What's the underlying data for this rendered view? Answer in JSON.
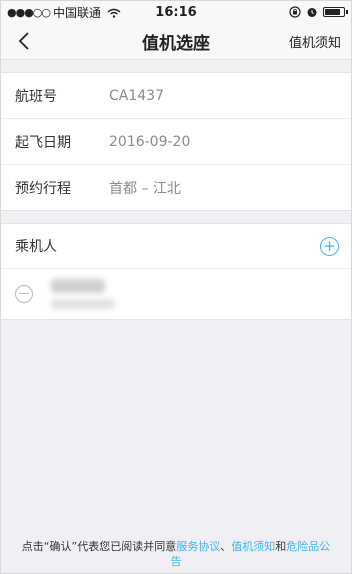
{
  "status_bar": {
    "signal": "●●●○○",
    "carrier": "中国联通",
    "time": "16:16",
    "battery_level": 0.85
  },
  "nav": {
    "title": "值机选座",
    "right_link": "值机须知"
  },
  "flight_info": {
    "flight_no_label": "航班号",
    "flight_no_value": "CA1437",
    "date_label": "起飞日期",
    "date_value": "2016-09-20",
    "route_label": "预约行程",
    "route_value": "首都 – 江北"
  },
  "passengers": {
    "header_label": "乘机人",
    "add_symbol": "+"
  },
  "footer": {
    "prefix": "点击“确认”代表您已阅读并同意",
    "service_agreement": "服务协议",
    "sep1": "、",
    "checkin_notice": "值机须知",
    "and": "和",
    "dangerous_goods": "危险品公告"
  },
  "colors": {
    "accent": "#3fb6e8",
    "background": "#efeff4"
  }
}
